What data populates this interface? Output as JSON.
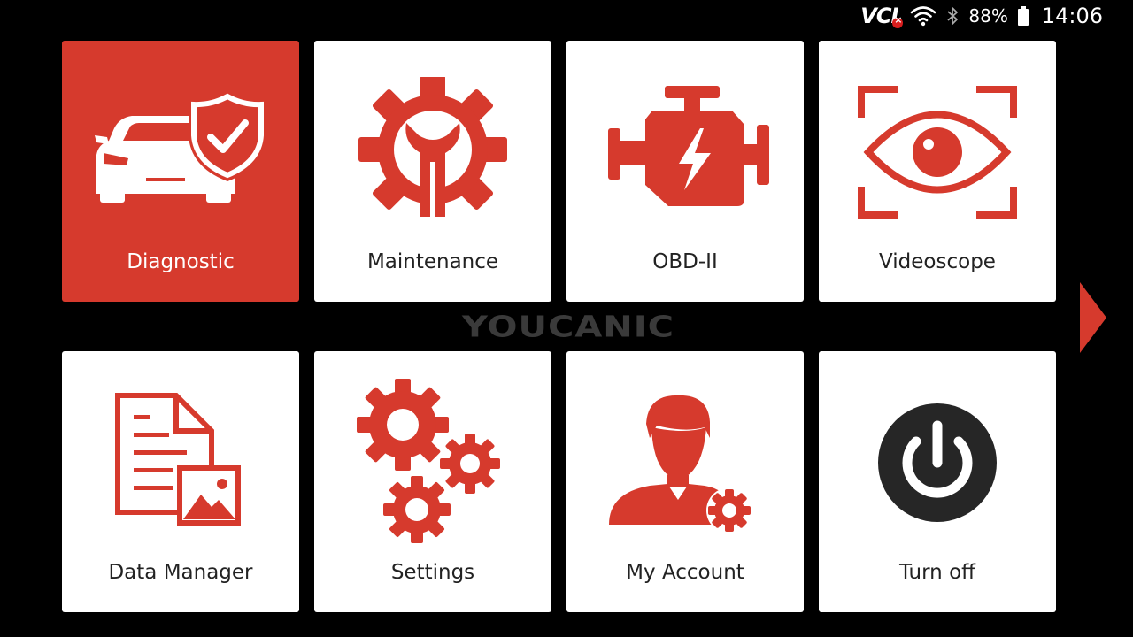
{
  "status_bar": {
    "vci_label": "VCI",
    "battery_percent": "88%",
    "time": "14:06"
  },
  "watermark": "YOUCANIC",
  "colors": {
    "accent": "#d63a2d",
    "tile_bg": "#ffffff",
    "background": "#000000",
    "power_icon_bg": "#262626"
  },
  "tiles": [
    {
      "label": "Diagnostic",
      "icon": "car-shield-icon",
      "selected": true
    },
    {
      "label": "Maintenance",
      "icon": "gear-wrench-icon",
      "selected": false
    },
    {
      "label": "OBD-II",
      "icon": "engine-icon",
      "selected": false
    },
    {
      "label": "Videoscope",
      "icon": "eye-scan-icon",
      "selected": false
    },
    {
      "label": "Data Manager",
      "icon": "document-image-icon",
      "selected": false
    },
    {
      "label": "Settings",
      "icon": "gears-icon",
      "selected": false
    },
    {
      "label": "My Account",
      "icon": "user-gear-icon",
      "selected": false
    },
    {
      "label": "Turn off",
      "icon": "power-icon",
      "selected": false
    }
  ],
  "navigation": {
    "next_icon": "chevron-right-icon"
  }
}
